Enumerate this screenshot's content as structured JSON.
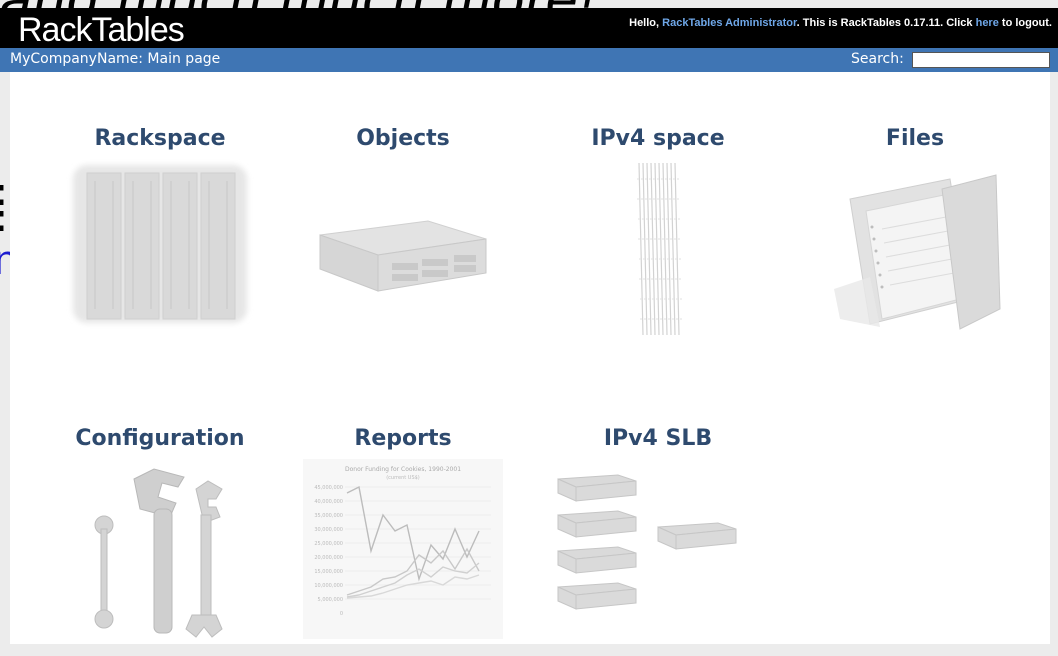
{
  "ghost": {
    "top_text": "and much much more!”",
    "left_colon1": ":",
    "left_colon2": ":",
    "left_n": "n"
  },
  "header": {
    "logo": "RackTables",
    "greeting_prefix": "Hello, ",
    "user_link": "RackTables Administrator",
    "greeting_mid": ". This is RackTables 0.17.11. Click ",
    "logout_link": "here",
    "greeting_suffix": " to logout."
  },
  "navbar": {
    "page_title": "MyCompanyName: Main page",
    "search_label": "Search:",
    "search_value": ""
  },
  "tiles": [
    {
      "label": "Rackspace",
      "icon": "rack-icon"
    },
    {
      "label": "Objects",
      "icon": "server-icon"
    },
    {
      "label": "IPv4 space",
      "icon": "ip-list-icon"
    },
    {
      "label": "Files",
      "icon": "folder-icon"
    },
    {
      "label": "Configuration",
      "icon": "wrench-icon"
    },
    {
      "label": "Reports",
      "icon": "report-chart-icon"
    },
    {
      "label": "IPv4 SLB",
      "icon": "slb-servers-icon"
    }
  ],
  "report_chart": {
    "title": "Donor Funding for Cookies, 1990-2001",
    "subtitle": "(current US$)",
    "ylabels": [
      "45,000,000",
      "40,000,000",
      "35,000,000",
      "30,000,000",
      "25,000,000",
      "20,000,000",
      "15,000,000",
      "10,000,000",
      "5,000,000",
      "0"
    ]
  },
  "colors": {
    "nav_blue": "#3f75b4",
    "link_blue": "#6fa7e8",
    "title_blue": "#2e4a6e"
  }
}
